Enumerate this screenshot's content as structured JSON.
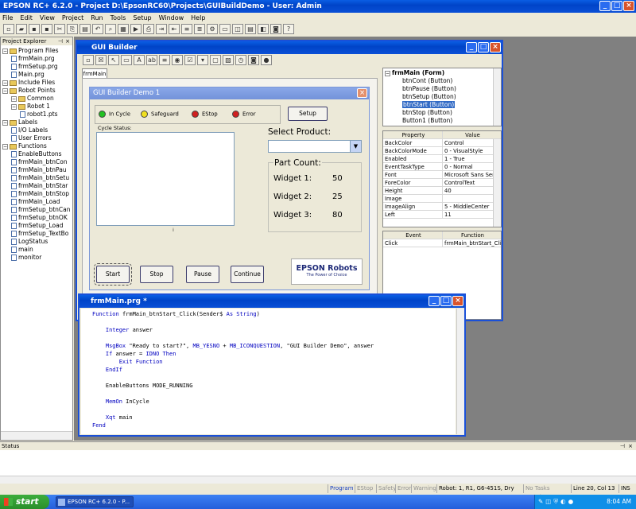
{
  "app": {
    "title": "EPSON RC+ 6.2.0 - Project D:\\EpsonRC60\\Projects\\GUIBuildDemo - User: Admin"
  },
  "menu": [
    "File",
    "Edit",
    "View",
    "Project",
    "Run",
    "Tools",
    "Setup",
    "Window",
    "Help"
  ],
  "project_explorer": {
    "title": "Project Explorer",
    "pin": "X",
    "items": [
      {
        "level": 0,
        "kind": "folder",
        "label": "Program Files"
      },
      {
        "level": 1,
        "kind": "file",
        "label": "frmMain.prg"
      },
      {
        "level": 1,
        "kind": "file",
        "label": "frmSetup.prg"
      },
      {
        "level": 1,
        "kind": "file",
        "label": "Main.prg"
      },
      {
        "level": 0,
        "kind": "folder",
        "label": "Include Files"
      },
      {
        "level": 0,
        "kind": "folder",
        "label": "Robot Points"
      },
      {
        "level": 1,
        "kind": "folder",
        "label": "Common"
      },
      {
        "level": 1,
        "kind": "folder",
        "label": "Robot 1"
      },
      {
        "level": 2,
        "kind": "file",
        "label": "robot1.pts"
      },
      {
        "level": 0,
        "kind": "folder",
        "label": "Labels"
      },
      {
        "level": 1,
        "kind": "file",
        "label": "I/O Labels"
      },
      {
        "level": 1,
        "kind": "file",
        "label": "User Errors"
      },
      {
        "level": 0,
        "kind": "folder",
        "label": "Functions"
      },
      {
        "level": 1,
        "kind": "file",
        "label": "EnableButtons"
      },
      {
        "level": 1,
        "kind": "file",
        "label": "frmMain_btnCon"
      },
      {
        "level": 1,
        "kind": "file",
        "label": "frmMain_btnPau"
      },
      {
        "level": 1,
        "kind": "file",
        "label": "frmMain_btnSetu"
      },
      {
        "level": 1,
        "kind": "file",
        "label": "frmMain_btnStar"
      },
      {
        "level": 1,
        "kind": "file",
        "label": "frmMain_btnStop"
      },
      {
        "level": 1,
        "kind": "file",
        "label": "frmMain_Load"
      },
      {
        "level": 1,
        "kind": "file",
        "label": "frmSetup_btnCan"
      },
      {
        "level": 1,
        "kind": "file",
        "label": "frmSetup_btnOK"
      },
      {
        "level": 1,
        "kind": "file",
        "label": "frmSetup_Load"
      },
      {
        "level": 1,
        "kind": "file",
        "label": "frmSetup_TextBo"
      },
      {
        "level": 1,
        "kind": "file",
        "label": "LogStatus"
      },
      {
        "level": 1,
        "kind": "file",
        "label": "main"
      },
      {
        "level": 1,
        "kind": "file",
        "label": "monitor"
      }
    ]
  },
  "gui_builder": {
    "title": "GUI Builder",
    "tab": "frmMain",
    "form": {
      "title": "GUI Builder Demo 1",
      "indicators": [
        {
          "label": "In Cycle",
          "color": "#22c022"
        },
        {
          "label": "Safeguard",
          "color": "#f0e020"
        },
        {
          "label": "EStop",
          "color": "#d02020"
        },
        {
          "label": "Error",
          "color": "#d02020"
        }
      ],
      "setup": "Setup",
      "cycle_status": "Cycle Status:",
      "select_product": "Select Product:",
      "part_count": "Part Count:",
      "widgets": [
        {
          "label": "Widget 1:",
          "value": "50"
        },
        {
          "label": "Widget 2:",
          "value": "25"
        },
        {
          "label": "Widget 3:",
          "value": "80"
        }
      ],
      "buttons": [
        "Start",
        "Stop",
        "Pause",
        "Continue"
      ],
      "logo_main": "EPSON Robots",
      "logo_sub": "The Power of Choice"
    },
    "tree": {
      "root": "frmMain (Form)",
      "items": [
        "btnCont (Button)",
        "btnPause (Button)",
        "btnSetup (Button)",
        "btnStart (Button)",
        "btnStop (Button)",
        "Button1 (Button)"
      ],
      "selected": 3
    },
    "properties": {
      "header": [
        "Property",
        "Value"
      ],
      "rows": [
        [
          "BackColor",
          "Control"
        ],
        [
          "BackColorMode",
          "0 - VisualStyle"
        ],
        [
          "Enabled",
          "1 - True"
        ],
        [
          "EventTaskType",
          "0 - Normal"
        ],
        [
          "Font",
          "Microsoft Sans Serif, 8"
        ],
        [
          "ForeColor",
          "ControlText"
        ],
        [
          "Height",
          "40"
        ],
        [
          "Image",
          ""
        ],
        [
          "ImageAlign",
          "5 - MiddleCenter"
        ],
        [
          "Left",
          "11"
        ]
      ]
    },
    "events": {
      "header": [
        "Event",
        "Function"
      ],
      "rows": [
        [
          "Click",
          "frmMain_btnStart_Click"
        ]
      ]
    }
  },
  "editor": {
    "title": "frmMain.prg *",
    "lines": [
      "Function frmMain_btnStart_Click(Sender$ As String)",
      "",
      "    Integer answer",
      "",
      "    MsgBox \"Ready to start?\", MB_YESNO + MB_ICONQUESTION, \"GUI Builder Demo\", answer",
      "    If answer = IDNO Then",
      "        Exit Function",
      "    EndIf",
      "",
      "    EnableButtons MODE_RUNNING",
      "",
      "    MemOn InCycle",
      "",
      "    Xqt main",
      "Fend"
    ]
  },
  "status": {
    "title": "Status",
    "cells": [
      "Program",
      "EStop",
      "Safety",
      "Error",
      "Warning",
      "Robot: 1, R1, G6-451S, Dry Run",
      "No Tasks Running",
      "Line 20, Col 13",
      "INS"
    ]
  },
  "taskbar": {
    "start": "start",
    "task": "EPSON RC+ 6.2.0 - P...",
    "clock": "8:04 AM"
  }
}
